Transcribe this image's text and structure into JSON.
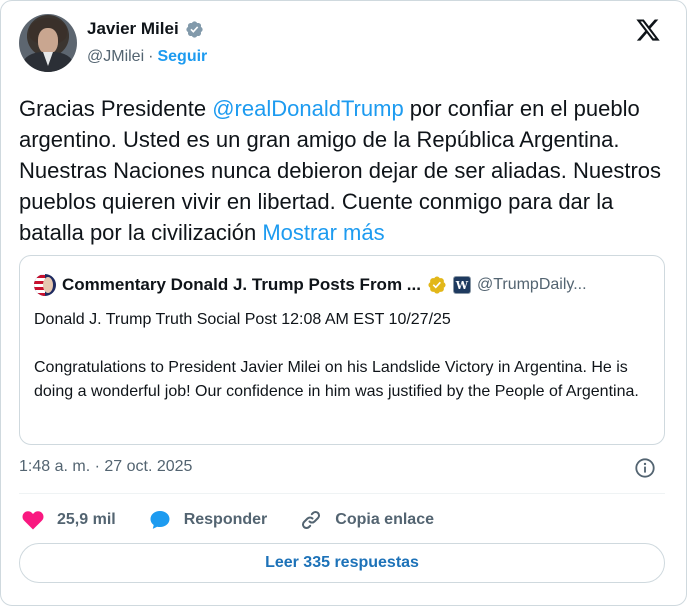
{
  "author": {
    "name": "Javier Milei",
    "handle": "@JMilei",
    "separator": "·",
    "follow_label": "Seguir"
  },
  "tweet": {
    "text_before": "Gracias Presidente ",
    "mention": "@realDonaldTrump",
    "text_after": " por confiar en el pueblo argentino. Usted es un gran amigo de la República Argentina. Nuestras Naciones nunca debieron dejar de ser aliadas. Nuestros pueblos quieren vivir en libertad. Cuente conmigo para dar la batalla por la civilización ",
    "show_more": "Mostrar más"
  },
  "quote": {
    "name": "Commentary Donald J. Trump Posts From ...",
    "badge_letter": "W",
    "handle": "@TrumpDaily...",
    "line1": "Donald J. Trump Truth Social Post 12:08 AM EST 10/27/25",
    "line2": "Congratulations to President Javier Milei on his Landslide Victory in Argentina. He is doing a wonderful job! Our confidence in him was justified by the People of Argentina."
  },
  "meta": {
    "timestamp": "1:48 a. m. · 27 oct. 2025"
  },
  "actions": {
    "likes": "25,9 mil",
    "reply_label": "Responder",
    "copy_link_label": "Copia enlace"
  },
  "read_replies_label": "Leer 335 respuestas",
  "colors": {
    "accent": "#1d9bf0",
    "like": "#f91880",
    "verified": "#829aab",
    "gold_verified": "#e2b719"
  },
  "icons": {
    "logo": "x-logo-icon",
    "verified": "verified-badge-icon",
    "info": "info-icon",
    "like": "heart-icon",
    "reply": "speech-bubble-icon",
    "copy_link": "link-icon"
  }
}
